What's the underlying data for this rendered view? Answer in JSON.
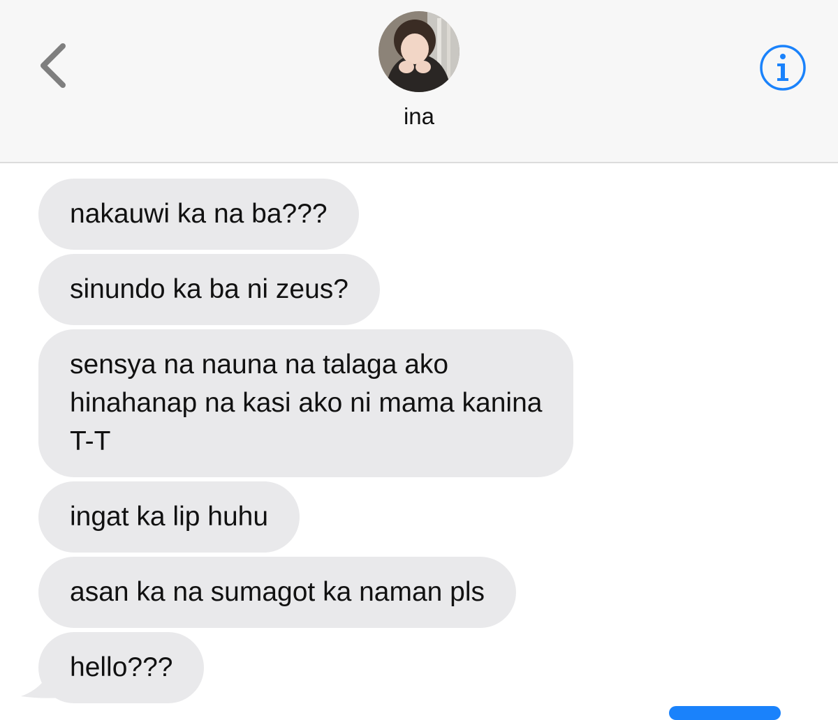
{
  "header": {
    "contact_name": "ina",
    "back_icon": "chevron-left-icon",
    "info_icon": "info-circle-icon",
    "avatar_icon": "contact-photo"
  },
  "colors": {
    "accent": "#1a82fb",
    "incoming_bubble": "#e9e9eb",
    "header_bg": "#f7f7f7",
    "back_icon": "#7f7f7f"
  },
  "messages": [
    {
      "direction": "incoming",
      "lines": [
        "nakauwi ka na ba???"
      ]
    },
    {
      "direction": "incoming",
      "lines": [
        "sinundo ka ba ni zeus?"
      ]
    },
    {
      "direction": "incoming",
      "lines": [
        "sensya na nauna na talaga ako",
        "hinahanap na kasi ako ni mama kanina",
        "T-T"
      ]
    },
    {
      "direction": "incoming",
      "lines": [
        "ingat ka lip huhu"
      ]
    },
    {
      "direction": "incoming",
      "lines": [
        "asan ka na sumagot ka naman pls"
      ]
    },
    {
      "direction": "incoming",
      "lines": [
        "hello???"
      ]
    }
  ]
}
